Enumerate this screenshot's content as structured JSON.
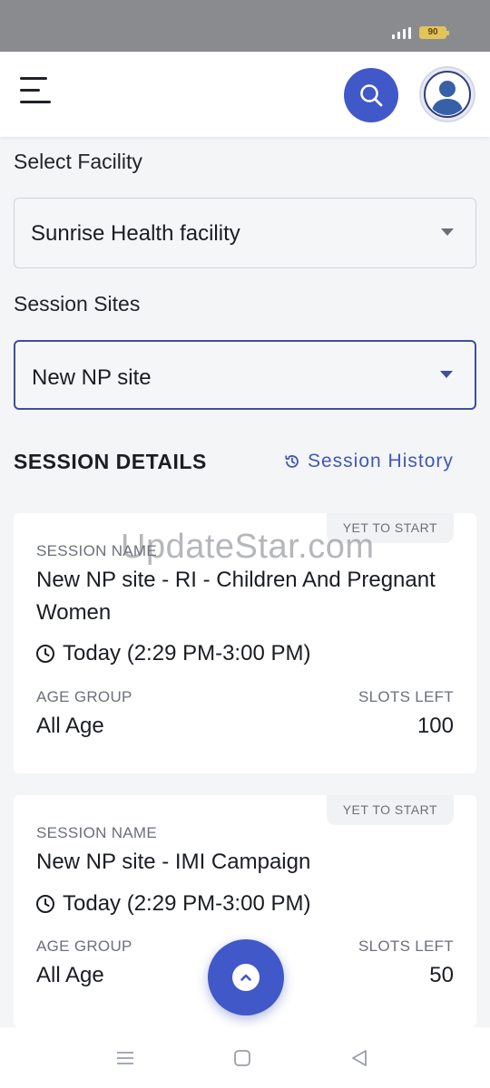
{
  "status_bar": {
    "battery": "90",
    "signal_icon": "signal-icon"
  },
  "header": {
    "menu_icon": "hamburger-menu-icon",
    "search_icon": "search-icon",
    "avatar_icon": "user-avatar-icon"
  },
  "facility": {
    "label": "Select Facility",
    "value": "Sunrise Health facility"
  },
  "sites": {
    "label": "Session Sites",
    "value": "New NP site"
  },
  "details": {
    "title": "SESSION DETAILS",
    "history_label": "Session History",
    "history_icon": "history-icon"
  },
  "watermark": "UpdateStar.com",
  "sessions": [
    {
      "badge": "YET TO START",
      "name_caption": "SESSION NAME",
      "name": "New NP site - RI - Children And Pregnant Women",
      "time": "Today (2:29 PM-3:00 PM)",
      "age_caption": "AGE GROUP",
      "age": "All Age",
      "slots_caption": "SLOTS LEFT",
      "slots": "100"
    },
    {
      "badge": "YET TO START",
      "name_caption": "SESSION NAME",
      "name": "New NP site - IMI Campaign",
      "time": "Today (2:29 PM-3:00 PM)",
      "age_caption": "AGE GROUP",
      "age": "All Age",
      "slots_caption": "SLOTS LEFT",
      "slots": "50"
    }
  ],
  "fab_icon": "chevron-up-icon",
  "nav": {
    "menu_icon": "recents-icon",
    "home_icon": "home-icon",
    "back_icon": "back-icon"
  },
  "colors": {
    "primary": "#4158c9",
    "link": "#3f58b6",
    "status_bar": "#8a8b8f",
    "battery": "#e3c35b"
  }
}
